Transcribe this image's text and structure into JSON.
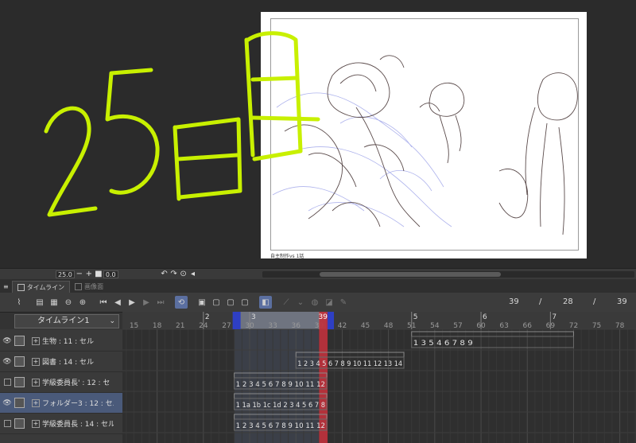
{
  "canvas": {
    "caption": "自主制作vs 1話",
    "overlay_text": "25日目",
    "colors": {
      "paper": "#ffffff",
      "overlay_text": "#c8f000",
      "sketch_dark": "#5a4a4a",
      "sketch_blue": "#9aa0e8"
    }
  },
  "status_bar": {
    "zoom_value": "25.0",
    "rotation_value": "0.0",
    "zoom_out_icon": "−",
    "zoom_in_icon": "+",
    "fit_icon": "■"
  },
  "panel_tabs": [
    {
      "label": "タイムライン",
      "icon": "timeline-icon"
    },
    {
      "label": "画像面",
      "icon": "camera-icon"
    }
  ],
  "toolbar": {
    "current_frame": "39",
    "start_frame": "28",
    "end_frame": "39",
    "separator": "/"
  },
  "timeline": {
    "name": "タイムライン1",
    "ruler_major": [
      {
        "label": "2",
        "frame": 24
      },
      {
        "label": "3",
        "frame": 30
      },
      {
        "label": "39",
        "frame": 39
      },
      {
        "label": "5",
        "frame": 51
      },
      {
        "label": "6",
        "frame": 60
      },
      {
        "label": "7",
        "frame": 69
      }
    ],
    "ruler_minor": [
      "15",
      "18",
      "21",
      "24",
      "27",
      "30",
      "33",
      "36",
      "39",
      "42",
      "45",
      "48",
      "51",
      "54",
      "57",
      "60",
      "63",
      "66",
      "69",
      "72",
      "75",
      "78"
    ],
    "playhead_frame": 39,
    "in_frame": 28,
    "out_frame": 39
  },
  "layers": [
    {
      "name": "生物 : 11 : セル",
      "visible": true,
      "selected": false,
      "cels": "1 3 5 4 6 7 8 9",
      "start": 51,
      "end": 72
    },
    {
      "name": "図書 : 14 : セル",
      "visible": true,
      "selected": false,
      "cels": "1 2 3 4 5 6 7 8 9 10 11 12 13 14",
      "start": 36,
      "end": 50
    },
    {
      "name": "学級委員長' : 12 : セ",
      "visible": false,
      "selected": false,
      "cels": "1 2 3 4 5 6 7 8 9 10 11 12",
      "start": 28,
      "end": 40
    },
    {
      "name": "フォルダー3 : 12 : セル",
      "visible": true,
      "selected": true,
      "cels": "1 1a 1b 1c 1d 2 3 4 5 6 7 8",
      "start": 28,
      "end": 40
    },
    {
      "name": "学級委員長 : 14 : セル",
      "visible": false,
      "selected": false,
      "cels": "1 2 3 4 5 6 7 8 9 10 11 12",
      "start": 28,
      "end": 40
    }
  ]
}
